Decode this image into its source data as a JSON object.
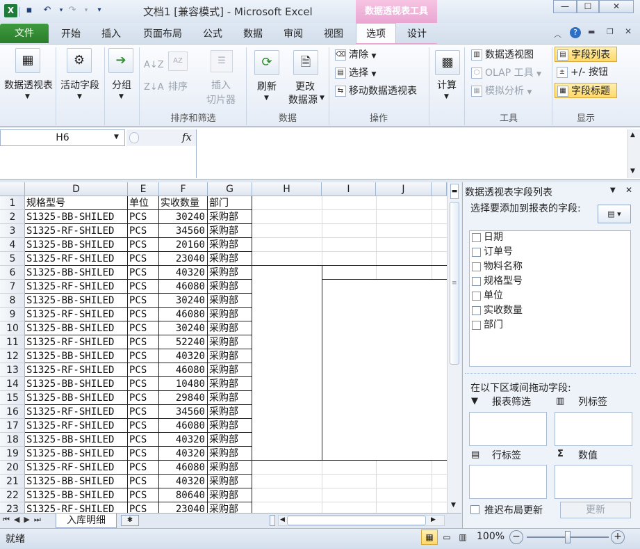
{
  "title_bar": {
    "title": "文档1  [兼容模式] - Microsoft Excel",
    "context_title": "数据透视表工具"
  },
  "tabs": [
    "文件",
    "开始",
    "插入",
    "页面布局",
    "公式",
    "数据",
    "审阅",
    "视图",
    "选项",
    "设计"
  ],
  "ribbon": {
    "pivot_table": "数据透视表",
    "active_field": "活动字段",
    "group": "分组",
    "sort_label": "排序",
    "insert_slicer_1": "插入",
    "insert_slicer_2": "切片器",
    "group_sort_filter": "排序和筛选",
    "refresh": "刷新",
    "change_source_1": "更改",
    "change_source_2": "数据源",
    "group_data": "数据",
    "clear": "清除",
    "select": "选择",
    "move_pivot": "移动数据透视表",
    "group_actions": "操作",
    "calculate": "计算",
    "pivot_chart": "数据透视图",
    "olap_tools": "OLAP 工具",
    "what_if": "模拟分析",
    "group_tools": "工具",
    "field_list": "字段列表",
    "plus_minus": "+/- 按钮",
    "field_headers": "字段标题",
    "group_show": "显示"
  },
  "formula_bar": {
    "name_box": "H6",
    "fx": "fx",
    "formula": ""
  },
  "columns": [
    "D",
    "E",
    "F",
    "G",
    "H",
    "I",
    "J"
  ],
  "headers": [
    "规格型号",
    "单位",
    "实收数量",
    "部门"
  ],
  "rows": [
    {
      "n": "2",
      "spec": "S1325-BB-SHILED",
      "unit": "PCS",
      "qty": "30240",
      "dept": "采购部"
    },
    {
      "n": "3",
      "spec": "S1325-RF-SHILED",
      "unit": "PCS",
      "qty": "34560",
      "dept": "采购部"
    },
    {
      "n": "4",
      "spec": "S1325-BB-SHILED",
      "unit": "PCS",
      "qty": "20160",
      "dept": "采购部"
    },
    {
      "n": "5",
      "spec": "S1325-RF-SHILED",
      "unit": "PCS",
      "qty": "23040",
      "dept": "采购部"
    },
    {
      "n": "6",
      "spec": "S1325-BB-SHILED",
      "unit": "PCS",
      "qty": "40320",
      "dept": "采购部"
    },
    {
      "n": "7",
      "spec": "S1325-RF-SHILED",
      "unit": "PCS",
      "qty": "46080",
      "dept": "采购部"
    },
    {
      "n": "8",
      "spec": "S1325-BB-SHILED",
      "unit": "PCS",
      "qty": "30240",
      "dept": "采购部"
    },
    {
      "n": "9",
      "spec": "S1325-RF-SHILED",
      "unit": "PCS",
      "qty": "46080",
      "dept": "采购部"
    },
    {
      "n": "10",
      "spec": "S1325-BB-SHILED",
      "unit": "PCS",
      "qty": "30240",
      "dept": "采购部"
    },
    {
      "n": "11",
      "spec": "S1325-RF-SHILED",
      "unit": "PCS",
      "qty": "52240",
      "dept": "采购部"
    },
    {
      "n": "12",
      "spec": "S1325-BB-SHILED",
      "unit": "PCS",
      "qty": "40320",
      "dept": "采购部"
    },
    {
      "n": "13",
      "spec": "S1325-RF-SHILED",
      "unit": "PCS",
      "qty": "46080",
      "dept": "采购部"
    },
    {
      "n": "14",
      "spec": "S1325-BB-SHILED",
      "unit": "PCS",
      "qty": "10480",
      "dept": "采购部"
    },
    {
      "n": "15",
      "spec": "S1325-BB-SHILED",
      "unit": "PCS",
      "qty": "29840",
      "dept": "采购部"
    },
    {
      "n": "16",
      "spec": "S1325-RF-SHILED",
      "unit": "PCS",
      "qty": "34560",
      "dept": "采购部"
    },
    {
      "n": "17",
      "spec": "S1325-RF-SHILED",
      "unit": "PCS",
      "qty": "46080",
      "dept": "采购部"
    },
    {
      "n": "18",
      "spec": "S1325-BB-SHILED",
      "unit": "PCS",
      "qty": "40320",
      "dept": "采购部"
    },
    {
      "n": "19",
      "spec": "S1325-BB-SHILED",
      "unit": "PCS",
      "qty": "40320",
      "dept": "采购部"
    },
    {
      "n": "20",
      "spec": "S1325-RF-SHILED",
      "unit": "PCS",
      "qty": "46080",
      "dept": "采购部"
    },
    {
      "n": "21",
      "spec": "S1325-BB-SHILED",
      "unit": "PCS",
      "qty": "40320",
      "dept": "采购部"
    },
    {
      "n": "22",
      "spec": "S1325-BB-SHILED",
      "unit": "PCS",
      "qty": "80640",
      "dept": "采购部"
    },
    {
      "n": "23",
      "spec": "S1325-RF-SHILED",
      "unit": "PCS",
      "qty": "23040",
      "dept": "采购部"
    }
  ],
  "sheet_tab": "入库明细",
  "field_pane": {
    "title": "数据透视表字段列表",
    "instruction": "选择要添加到报表的字段:",
    "fields": [
      "日期",
      "订单号",
      "物料名称",
      "规格型号",
      "单位",
      "实收数量",
      "部门"
    ],
    "drag_text": "在以下区域间拖动字段:",
    "report_filter": "报表筛选",
    "column_labels": "列标签",
    "row_labels": "行标签",
    "values": "数值",
    "defer_update": "推迟布局更新",
    "update_button": "更新"
  },
  "status": {
    "ready": "就绪",
    "zoom": "100%",
    "zoom_level": 1.0
  }
}
